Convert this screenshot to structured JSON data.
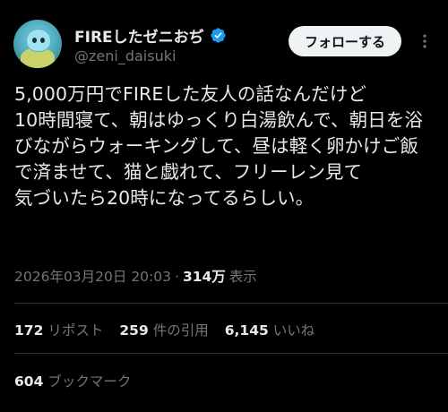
{
  "author": {
    "display_name": "FIREしたゼニおぢ",
    "handle": "@zeni_daisuki",
    "verified_icon": "verified-badge-icon",
    "verified_color": "#1d9bf0"
  },
  "actions": {
    "follow_label": "フォローする",
    "more_icon": "more-options-icon"
  },
  "tweet": {
    "text": "5,000万円でFIREした友人の話なんだけど\n10時間寝て、朝はゆっくり白湯飲んで、朝日を浴びながらウォーキングして、昼は軽く卵かけご飯で済ませて、猫と戯れて、フリーレン見て\n気づいたら20時になってるらしい。"
  },
  "meta": {
    "timestamp": "2026年03月20日 20:03",
    "separator": "·",
    "views_count": "314万",
    "views_label": "表示"
  },
  "stats": {
    "reposts_count": "172",
    "reposts_label": "リポスト",
    "quotes_count": "259",
    "quotes_label": "件の引用",
    "likes_count": "6,145",
    "likes_label": "いいね",
    "bookmarks_count": "604",
    "bookmarks_label": "ブックマーク"
  },
  "colors": {
    "background": "#000000",
    "text_primary": "#e7e9ea",
    "text_secondary": "#71767b",
    "divider": "#2f3336",
    "follow_button_bg": "#eff3f4"
  }
}
